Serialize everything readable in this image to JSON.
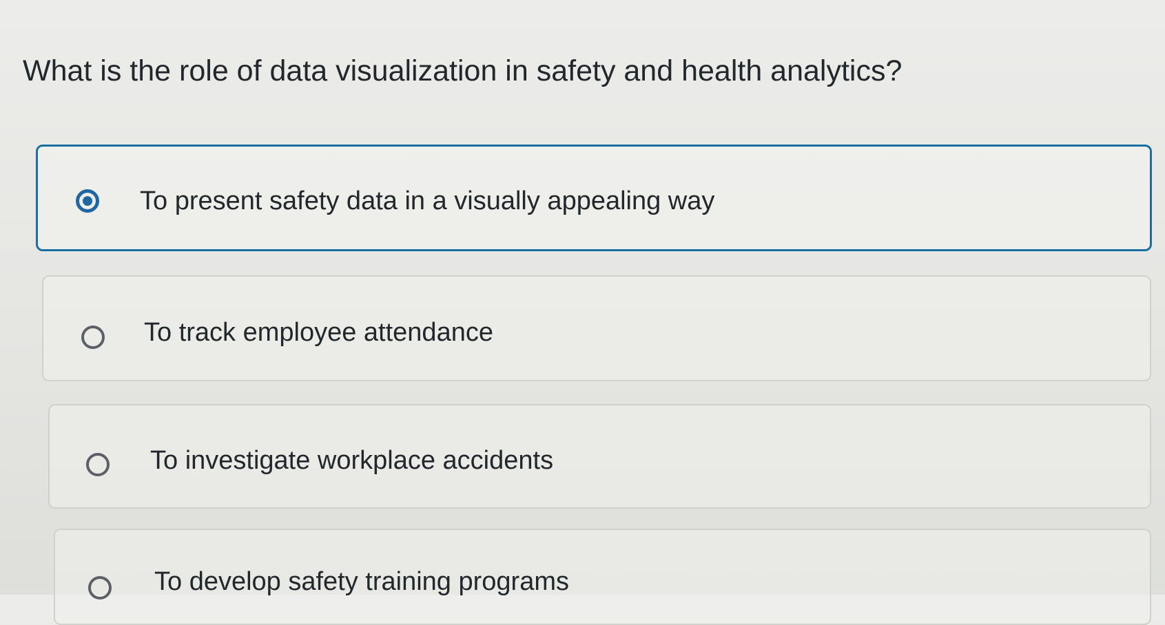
{
  "question": {
    "text": "What is the role of data visualization in safety and health analytics?"
  },
  "options": [
    {
      "label": "To present safety data in a visually appealing way",
      "selected": true
    },
    {
      "label": "To track employee attendance",
      "selected": false
    },
    {
      "label": "To investigate workplace accidents",
      "selected": false
    },
    {
      "label": "To develop safety training programs",
      "selected": false
    }
  ],
  "colors": {
    "selected_border": "#1a6fa2",
    "selected_radio": "#1f67a3",
    "unselected_border": "#cfd1cd",
    "unselected_radio": "#5c6066",
    "text": "#22272c",
    "background": "#e8e8e5"
  },
  "icons": {
    "selected_radio": "radio-selected-icon",
    "unselected_radio": "radio-unselected-icon"
  }
}
